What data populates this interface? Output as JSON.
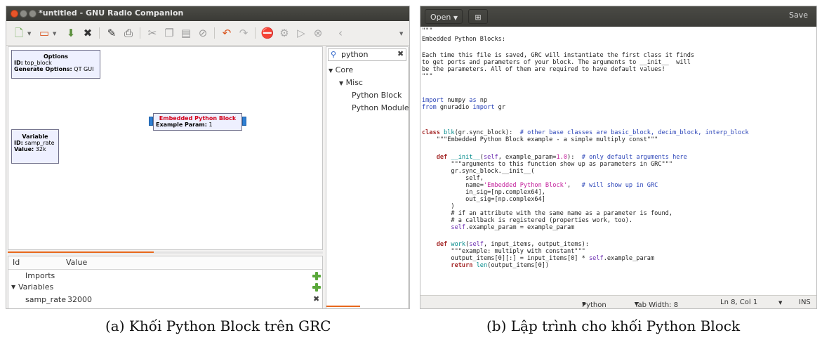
{
  "grc": {
    "window_title": "*untitled - GNU Radio Companion",
    "toolbar_icons": [
      "new-icon",
      "open-icon",
      "save-icon",
      "close-icon",
      "edit-icon",
      "print-icon",
      "cut-icon",
      "copy-icon",
      "paste-icon",
      "delete-icon",
      "undo-icon",
      "redo-icon",
      "stop-icon",
      "generate-icon",
      "run-icon",
      "kill-icon",
      "back-icon"
    ],
    "blocks": {
      "options": {
        "title": "Options",
        "rows": [
          {
            "k": "ID:",
            "v": " top_block"
          },
          {
            "k": "Generate Options:",
            "v": " QT GUI"
          }
        ]
      },
      "variable": {
        "title": "Variable",
        "rows": [
          {
            "k": "ID:",
            "v": " samp_rate"
          },
          {
            "k": "Value:",
            "v": " 32k"
          }
        ]
      },
      "embedded": {
        "title": "Embedded Python Block",
        "title_color": "#d4001a",
        "rows": [
          {
            "k": "Example Param:",
            "v": " 1"
          }
        ]
      }
    },
    "vars_table": {
      "col_id": "Id",
      "col_value": "Value",
      "imports_label": "Imports",
      "variables_label": "Variables",
      "samp_rate_label": "samp_rate",
      "samp_rate_value": "32000"
    },
    "tree": {
      "search_value": "python",
      "core": "Core",
      "misc": "Misc",
      "python_block": "Python Block",
      "python_module": "Python Module",
      "expander_glyph": "▼"
    }
  },
  "gedit": {
    "open_label": "Open",
    "save_label": "Save",
    "status": {
      "language": "Python",
      "tab_width": "Tab Width: 8",
      "position": "Ln 8, Col 1",
      "mode": "INS"
    },
    "code": {
      "l01": "\"\"\"",
      "l02": "Embedded Python Blocks:",
      "l03": "",
      "l04": "Each time this file is saved, GRC will instantiate the first class it finds",
      "l05": "to get ports and parameters of your block. The arguments to __init__  will",
      "l06": "be the parameters. All of them are required to have default values!",
      "l07": "\"\"\"",
      "l08": "",
      "l09_import": "import",
      "l09_rest": " numpy ",
      "l09_as": "as",
      "l09_np": " np",
      "l10_from": "from",
      "l10_mod": " gnuradio ",
      "l10_import": "import",
      "l10_gr": " gr",
      "l11": "",
      "l12_class": "class",
      "l12_name": " blk",
      "l12_args": "(gr.sync_block):  ",
      "l12_comment": "# other base classes are basic_block, decim_block, interp_block",
      "l13": "    \"\"\"Embedded Python Block example - a simple multiply const\"\"\"",
      "l14": "",
      "l15_def": "    def",
      "l15_name": " __init__",
      "l15_a": "(",
      "l15_self": "self",
      "l15_b": ", example_param=",
      "l15_num": "1.0",
      "l15_c": "):  ",
      "l15_comment": "# only default arguments here",
      "l16": "        \"\"\"arguments to this function show up as parameters in GRC\"\"\"",
      "l17": "        gr.sync_block.__init__(",
      "l18": "            self,",
      "l19_a": "            name=",
      "l19_str": "'Embedded Python Block'",
      "l19_b": ",   ",
      "l19_comment": "# will show up in GRC",
      "l20": "            in_sig=[np.complex64],",
      "l21": "            out_sig=[np.complex64]",
      "l22": "        )",
      "l23": "        # if an attribute with the same name as a parameter is found,",
      "l24": "        # a callback is registered (properties work, too).",
      "l25_self": "        self",
      "l25_rest": ".example_param = example_param",
      "l26": "",
      "l27_def": "    def",
      "l27_name": " work",
      "l27_a": "(",
      "l27_self": "self",
      "l27_b": ", input_items, output_items):",
      "l28": "        \"\"\"example: multiply with constant\"\"\"",
      "l29_a": "        output_items[0][:] = input_items[0] * ",
      "l29_self": "self",
      "l29_b": ".example_param",
      "l30_ret": "        return",
      "l30_len": " len",
      "l30_rest": "(output_items[0])"
    }
  },
  "captions": {
    "left": "(a) Khối Python Block trên GRC",
    "right": "(b) Lập trình cho khối Python Block"
  }
}
